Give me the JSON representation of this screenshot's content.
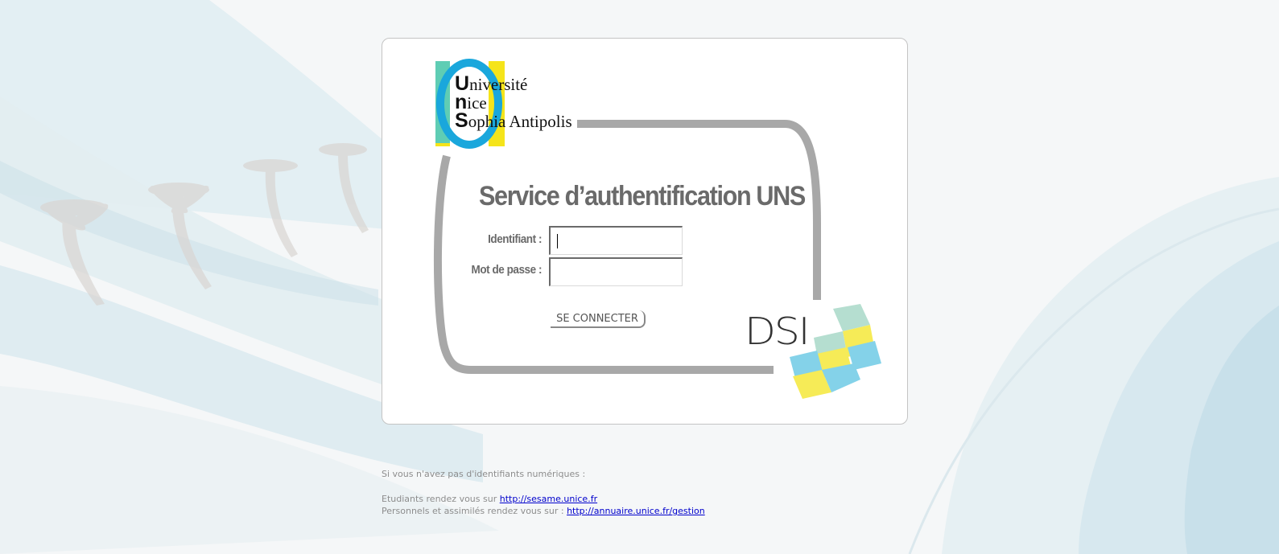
{
  "logo": {
    "line1_initial": "U",
    "line1_rest": "niversité",
    "line2_initial": "n",
    "line2_rest": "ice",
    "line3_initial": "S",
    "line3_rest": "ophia Antipolis"
  },
  "title": "Service d’authentification UNS",
  "form": {
    "username_label": "Identifiant :",
    "password_label": "Mot de passe :",
    "username_value": "",
    "password_value": "",
    "submit_label": "SE CONNECTER"
  },
  "dsi_logo_text": "DSI",
  "info": {
    "heading": "Si vous n'avez pas d'identifiants numériques :",
    "students_text": "Etudiants rendez vous sur ",
    "students_link": "http://sesame.unice.fr",
    "staff_text": "Personnels et assimilés rendez vous sur : ",
    "staff_link": "http://annuaire.unice.fr/gestion"
  },
  "colors": {
    "logo_cyan": "#1aa7dc",
    "logo_teal": "#5fcdb4",
    "logo_yellow": "#f5e41a",
    "frame_gray": "#a8a8a8",
    "title_gray": "#6a6a6a",
    "cube_blue": "#6fcbe6",
    "cube_yellow": "#f5e83a",
    "cube_mint": "#a9d9c8",
    "link_blue": "#0000cc"
  }
}
